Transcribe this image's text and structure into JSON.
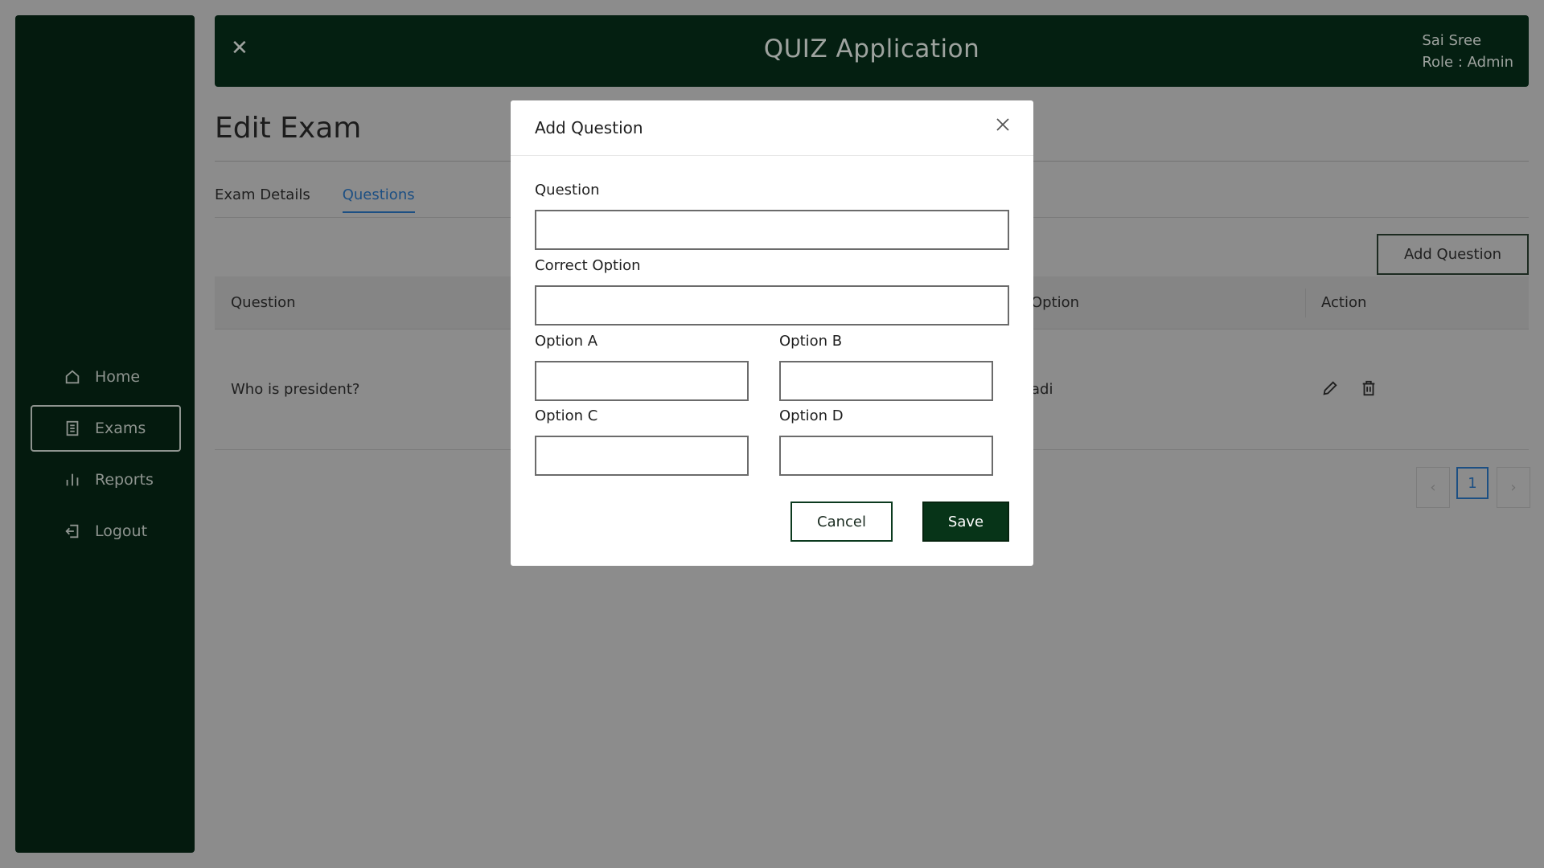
{
  "header": {
    "title": "QUIZ Application",
    "user_name": "Sai Sree",
    "user_role": "Role : Admin"
  },
  "sidebar": {
    "items": [
      {
        "label": "Home",
        "icon": "home-icon"
      },
      {
        "label": "Exams",
        "icon": "document-icon",
        "active": true
      },
      {
        "label": "Reports",
        "icon": "bar-chart-icon"
      },
      {
        "label": "Logout",
        "icon": "logout-icon"
      }
    ]
  },
  "page": {
    "title": "Edit Exam",
    "tabs": [
      {
        "label": "Exam Details"
      },
      {
        "label": "Questions",
        "active": true
      }
    ],
    "add_question_label": "Add Question"
  },
  "table": {
    "columns": [
      "Question",
      "Option",
      "Action"
    ],
    "rows": [
      {
        "question": "Who is president?",
        "option": "adi"
      }
    ]
  },
  "pagination": {
    "prev": "‹",
    "current": "1",
    "next": "›"
  },
  "modal": {
    "title": "Add Question",
    "fields": {
      "question": {
        "label": "Question",
        "value": ""
      },
      "correct_option": {
        "label": "Correct Option",
        "value": ""
      },
      "option_a": {
        "label": "Option A",
        "value": ""
      },
      "option_b": {
        "label": "Option B",
        "value": ""
      },
      "option_c": {
        "label": "Option C",
        "value": ""
      },
      "option_d": {
        "label": "Option D",
        "value": ""
      }
    },
    "cancel_label": "Cancel",
    "save_label": "Save"
  },
  "colors": {
    "sidebar_bg": "#041a0e",
    "header_bg": "#041f11",
    "overlay": "#8c8c8c",
    "accent_blue": "#1c4f83",
    "save_button": "#073418"
  }
}
